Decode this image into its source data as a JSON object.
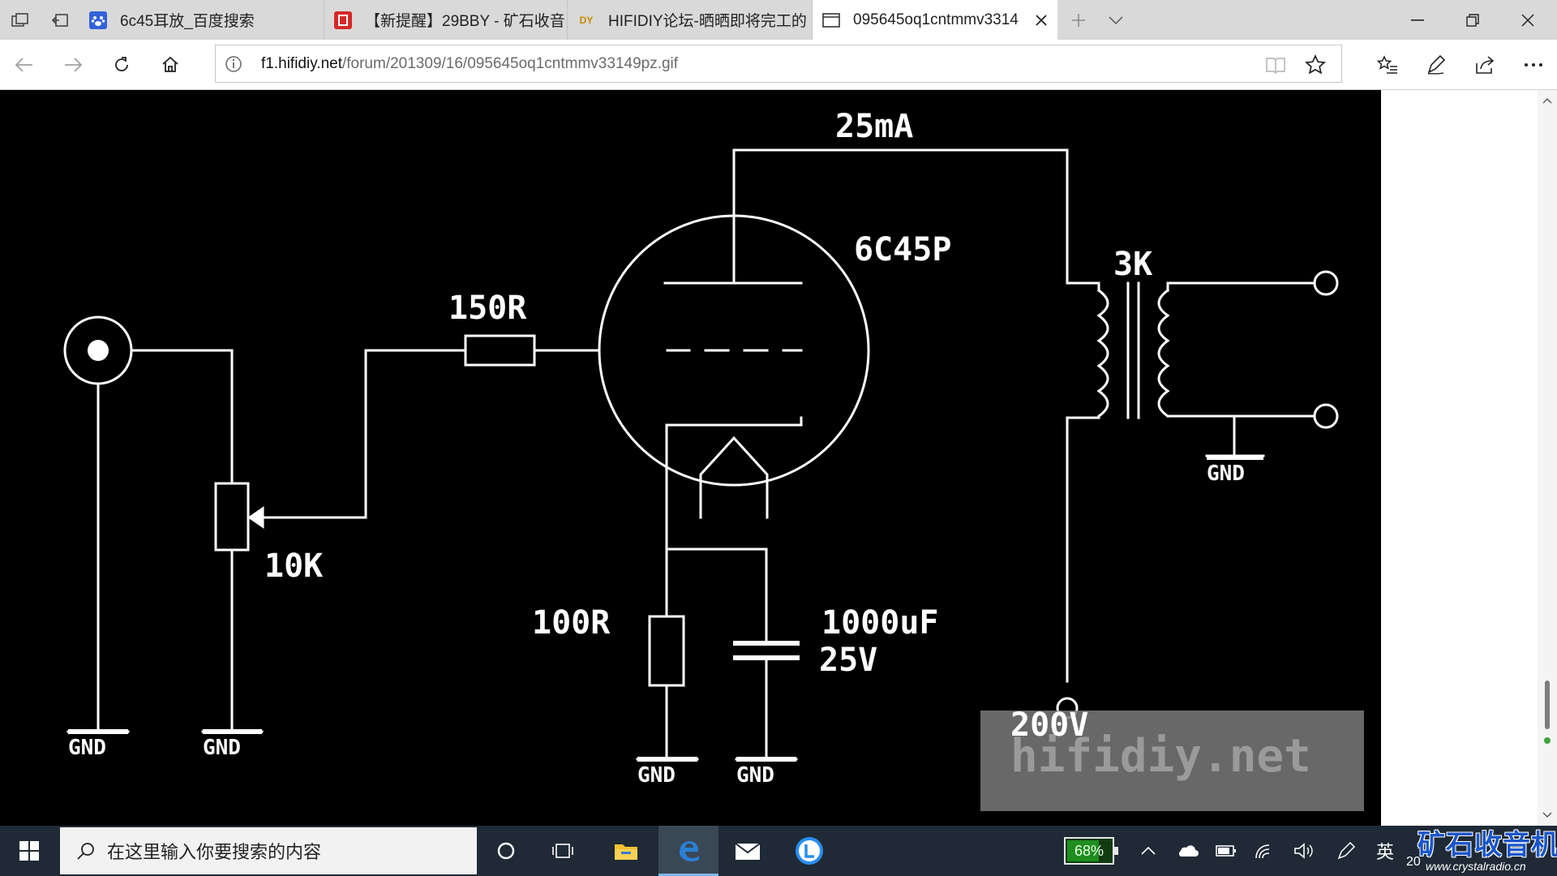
{
  "browser": {
    "tabs": [
      {
        "title": "6c45耳放_百度搜索",
        "active": false,
        "favicon": "paw-icon"
      },
      {
        "title": "【新提醒】29BBY - 矿石收音",
        "active": false,
        "favicon": "app-icon"
      },
      {
        "title": "HIFIDIY论坛-晒晒即将完工的",
        "active": false,
        "favicon": "diy-icon"
      },
      {
        "title": "095645oq1cntmmv3314",
        "active": true,
        "favicon": "page-icon"
      }
    ],
    "address": {
      "domain": "f1.hifidiy.net",
      "path": "/forum/201309/16/095645oq1cntmmv33149pz.gif"
    }
  },
  "schematic": {
    "labels": {
      "current": "25mA",
      "tube": "6C45P",
      "grid_resistor": "150R",
      "transformer": "3K",
      "pot": "10K",
      "cathode_resistor": "100R",
      "cap_value": "1000uF",
      "cap_voltage": "25V",
      "supply": "200V",
      "gnd": "GND"
    },
    "watermark": "hifidiy.net"
  },
  "taskbar": {
    "search_placeholder": "在这里输入你要搜索的内容",
    "battery_percent": "68%",
    "ime": "英",
    "clock_partial": "20",
    "watermark_title": "矿石收音机",
    "watermark_url": "www.crystalradio.cn"
  },
  "colors": {
    "tabbar_bg": "#d9d9d9",
    "taskbar_bg": "#1f2a36",
    "schematic_bg": "#000000",
    "schematic_ink": "#ffffff",
    "battery_green": "#1e8d1e",
    "brand_blue": "#1b56c8"
  }
}
